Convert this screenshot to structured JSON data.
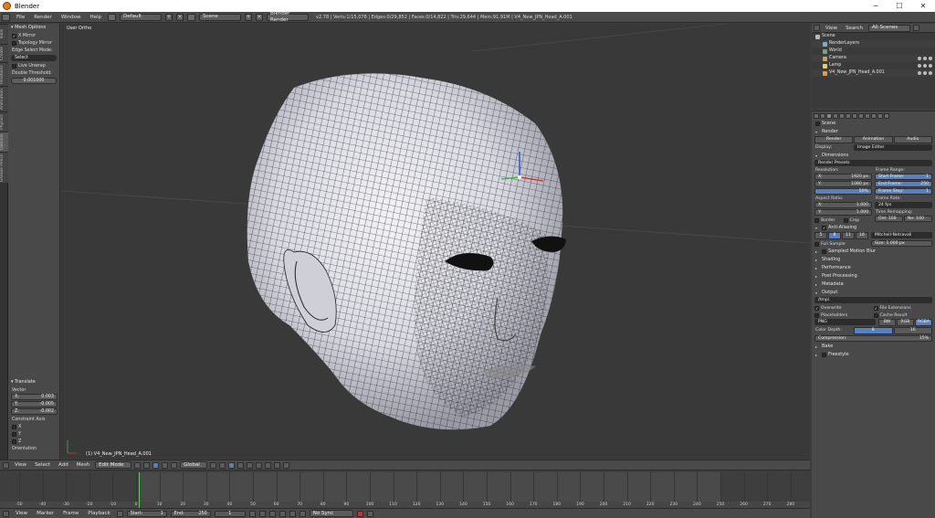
{
  "window": {
    "title": "Blender",
    "min": "─",
    "max": "☐",
    "close": "✕"
  },
  "info_header": {
    "menus": [
      "File",
      "Render",
      "Window",
      "Help"
    ],
    "screen_layout": "Default",
    "scene": "Scene",
    "engine": "Blender Render",
    "stats": "v2.78 | Verts:1/15,078 | Edges:0/29,852 | Faces:0/14,822 | Tris:29,644 | Mem:91.91M | V4_New_JPN_Head_A.001"
  },
  "tool_tabs": [
    "Tools",
    "Create",
    "Relations",
    "Animation",
    "Physics",
    "Options",
    "Grease Pencil"
  ],
  "tool_shelf": {
    "panel_title": "Mesh Options",
    "x_mirror": "X Mirror",
    "topology_mirror": "Topology Mirror",
    "edge_select_mode_label": "Edge Select Mode:",
    "edge_select_mode": "Select",
    "live_unwrap": "Live Unwrap",
    "double_threshold_label": "Double Threshold:",
    "double_threshold": "0.001000",
    "operator_title": "Translate",
    "vector_label": "Vector",
    "vector": [
      {
        "axis": "X:",
        "value": "0.003"
      },
      {
        "axis": "Y:",
        "value": "-0.005"
      },
      {
        "axis": "Z:",
        "value": "-0.002"
      }
    ],
    "constraint_label": "Constraint Axis",
    "constraint_axes": [
      "X",
      "Y",
      "Z"
    ],
    "orientation_label": "Orientation"
  },
  "viewport": {
    "view_name": "User Ortho",
    "object_label": "(1) V4_New_JPN_Head_A.001"
  },
  "viewport_header": {
    "menus": [
      "View",
      "Select",
      "Add",
      "Mesh"
    ],
    "mode": "Edit Mode",
    "pivot": "Global"
  },
  "timeline": {
    "ticks": [
      "-50",
      "-40",
      "-30",
      "-20",
      "-10",
      "0",
      "10",
      "20",
      "30",
      "40",
      "50",
      "60",
      "70",
      "80",
      "90",
      "100",
      "110",
      "120",
      "130",
      "140",
      "150",
      "160",
      "170",
      "180",
      "190",
      "200",
      "210",
      "220",
      "230",
      "240",
      "250",
      "260",
      "270",
      "280"
    ],
    "frame_start": 1,
    "frame_end": 250,
    "current_frame": 1,
    "menus": [
      "View",
      "Marker",
      "Frame",
      "Playback"
    ],
    "start_label": "Start:",
    "end_label": "End:",
    "start_value": "1",
    "end_value": "250",
    "current_value": "1",
    "sync": "No Sync"
  },
  "outliner": {
    "menus": [
      "View",
      "Search"
    ],
    "filter": "All Scenes",
    "items": [
      {
        "label": "Scene",
        "indent": 0,
        "color": "#b8b8b8"
      },
      {
        "label": "RenderLayers",
        "indent": 1,
        "color": "#8fa6c9"
      },
      {
        "label": "World",
        "indent": 1,
        "color": "#7ca07c"
      },
      {
        "label": "Camera",
        "indent": 1,
        "color": "#c9a066"
      },
      {
        "label": "Lamp",
        "indent": 1,
        "color": "#e0d070"
      },
      {
        "label": "V4_New_JPN_Head_A.001",
        "indent": 1,
        "color": "#e59b4b"
      }
    ]
  },
  "properties": {
    "context": "Scene",
    "render_panel": "Render",
    "render_buttons": [
      "Render",
      "Animation",
      "Audio"
    ],
    "display_label": "Display:",
    "display_value": "Image Editor",
    "dimensions_panel": "Dimensions",
    "render_presets": "Render Presets",
    "resolution_label": "Resolution:",
    "res_x_label": "X:",
    "res_x": "1920 px",
    "res_y_label": "Y:",
    "res_y": "1080 px",
    "res_pct": "50%",
    "frame_range_label": "Frame Range:",
    "start_frame_label": "Start Frame:",
    "start_frame": "1",
    "end_frame_label": "End Frame:",
    "end_frame": "250",
    "frame_step_label": "Frame Step:",
    "frame_step": "1",
    "aspect_label": "Aspect Ratio:",
    "aspect_x_label": "X:",
    "aspect_x": "1.000",
    "aspect_y_label": "Y:",
    "aspect_y": "1.000",
    "frame_rate_label": "Frame Rate:",
    "frame_rate": "24 fps",
    "time_remap_label": "Time Remapping:",
    "time_old": "Old: 100",
    "time_new": "Ne: 100",
    "border_label": "Border",
    "crop_label": "Crop",
    "aa_panel": "Anti-Aliasing",
    "aa_samples": [
      "5",
      "8",
      "11",
      "16"
    ],
    "aa_filter": "Mitchell-Netravali",
    "full_sample": "Full Sample",
    "aa_size": "Size: 1.000 px",
    "collapsed_panels": [
      "Sampled Motion Blur",
      "Shading",
      "Performance",
      "Post Processing",
      "Metadata"
    ],
    "output_panel": "Output",
    "output_path": "/tmp\\",
    "overwrite": "Overwrite",
    "file_extensions": "File Extensions",
    "placeholders": "Placeholders",
    "cache_result": "Cache Result",
    "file_format": "PNG",
    "color_modes": [
      "BW",
      "RGB",
      "RGBA"
    ],
    "color_depth_label": "Color Depth:",
    "color_depths": [
      "8",
      "16"
    ],
    "compression": "Compression:",
    "compression_value": "15%",
    "tail_panels": [
      "Bake",
      "Freestyle"
    ]
  }
}
